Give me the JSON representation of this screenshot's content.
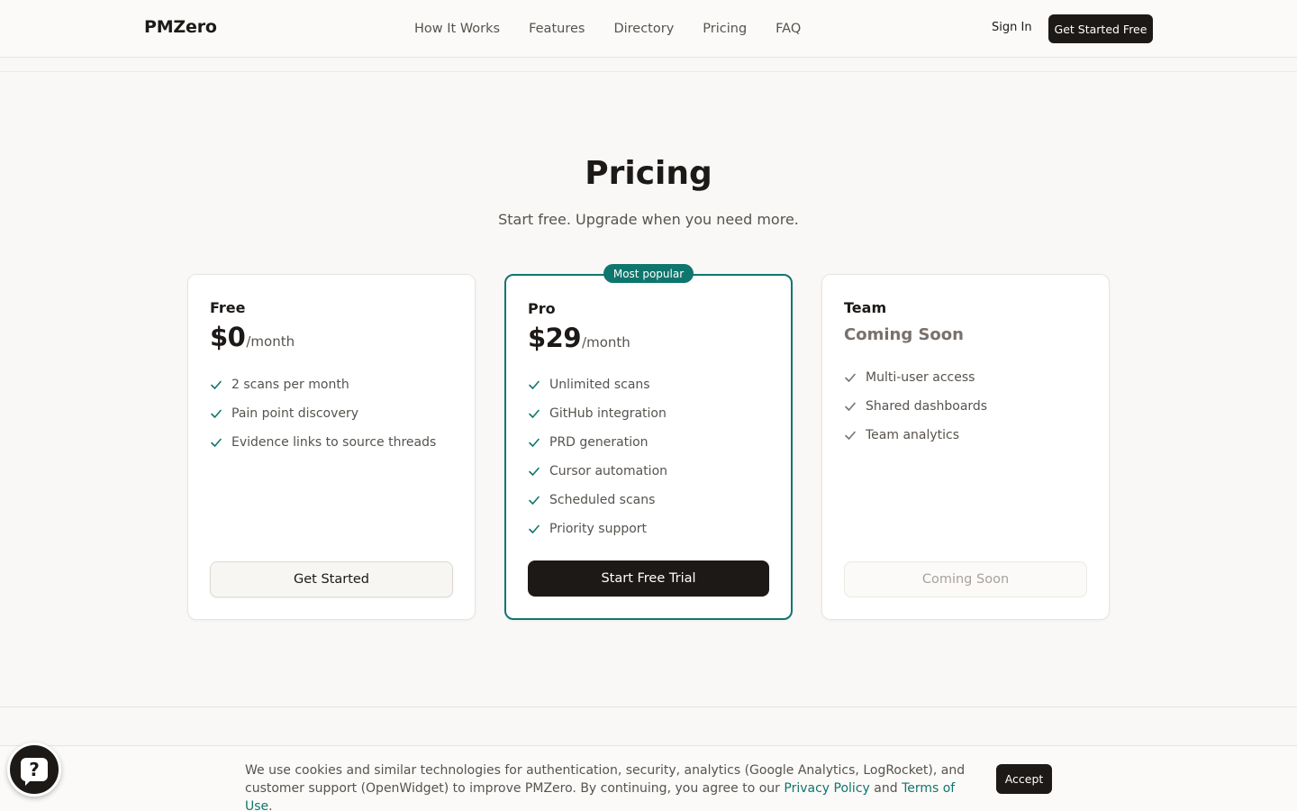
{
  "header": {
    "brand": "PMZero",
    "nav": [
      "How It Works",
      "Features",
      "Directory",
      "Pricing",
      "FAQ"
    ],
    "sign_in": "Sign In",
    "cta": "Get Started Free"
  },
  "pricing": {
    "title": "Pricing",
    "subtitle": "Start free. Upgrade when you need more.",
    "plans": [
      {
        "name": "Free",
        "price": "$0",
        "period": "/month",
        "features": [
          "2 scans per month",
          "Pain point discovery",
          "Evidence links to source threads"
        ],
        "button": "Get Started"
      },
      {
        "name": "Pro",
        "badge": "Most popular",
        "price": "$29",
        "period": "/month",
        "features": [
          "Unlimited scans",
          "GitHub integration",
          "PRD generation",
          "Cursor automation",
          "Scheduled scans",
          "Priority support"
        ],
        "button": "Start Free Trial"
      },
      {
        "name": "Team",
        "status": "Coming Soon",
        "features": [
          "Multi-user access",
          "Shared dashboards",
          "Team analytics"
        ],
        "button": "Coming Soon"
      }
    ]
  },
  "cookie": {
    "text_before": "We use cookies and similar technologies for authentication, security, analytics (Google Analytics, LogRocket), and customer support (OpenWidget) to improve PMZero. By continuing, you agree to our ",
    "privacy_link": "Privacy Policy",
    "and": " and ",
    "terms_link": "Terms of Use",
    "period": ".",
    "accept": "Accept"
  },
  "help_widget": {
    "icon": "question-mark-icon",
    "glyph": "?"
  },
  "colors": {
    "accent": "#0f766e",
    "dark": "#1c1917",
    "background": "#f9f8f6"
  }
}
